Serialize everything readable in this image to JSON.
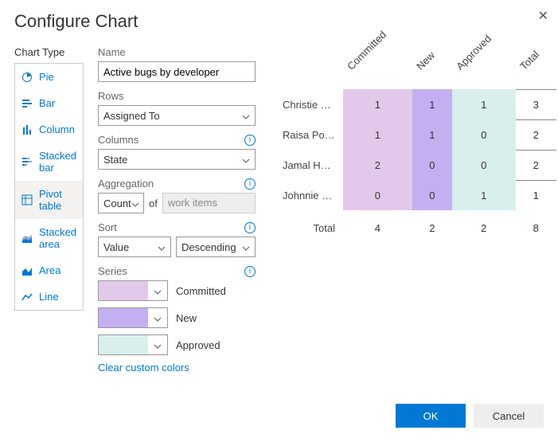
{
  "dialog": {
    "title": "Configure Chart"
  },
  "chartType": {
    "label": "Chart Type",
    "items": [
      {
        "key": "pie",
        "label": "Pie"
      },
      {
        "key": "bar",
        "label": "Bar"
      },
      {
        "key": "column",
        "label": "Column"
      },
      {
        "key": "stacked-bar",
        "label": "Stacked bar"
      },
      {
        "key": "pivot-table",
        "label": "Pivot table"
      },
      {
        "key": "stacked-area",
        "label": "Stacked area"
      },
      {
        "key": "area",
        "label": "Area"
      },
      {
        "key": "line",
        "label": "Line"
      }
    ],
    "selected": "pivot-table"
  },
  "form": {
    "nameLabel": "Name",
    "nameValue": "Active bugs by developer",
    "rowsLabel": "Rows",
    "rowsValue": "Assigned To",
    "columnsLabel": "Columns",
    "columnsValue": "State",
    "aggLabel": "Aggregation",
    "aggValue": "Count",
    "aggOf": "of",
    "aggWI": "work items",
    "sortLabel": "Sort",
    "sortBy": "Value",
    "sortDir": "Descending",
    "seriesLabel": "Series",
    "series": [
      {
        "label": "Committed",
        "color": "#e2c9ea"
      },
      {
        "label": "New",
        "color": "#c4b0f0"
      },
      {
        "label": "Approved",
        "color": "#d9efed"
      }
    ],
    "clearColors": "Clear custom colors"
  },
  "buttons": {
    "ok": "OK",
    "cancel": "Cancel"
  },
  "chart_data": {
    "type": "table",
    "columns": [
      "Committed",
      "New",
      "Approved",
      "Total"
    ],
    "rows": [
      {
        "label": "Christie Ch...",
        "values": [
          1,
          1,
          1,
          3
        ]
      },
      {
        "label": "Raisa Pokro...",
        "values": [
          1,
          1,
          0,
          2
        ]
      },
      {
        "label": "Jamal Hartn...",
        "values": [
          2,
          0,
          0,
          2
        ]
      },
      {
        "label": "Johnnie McL...",
        "values": [
          0,
          0,
          1,
          1
        ]
      }
    ],
    "totals": {
      "label": "Total",
      "values": [
        4,
        2,
        2,
        8
      ]
    },
    "column_colors": [
      "#e2c9ea",
      "#c4b0f0",
      "#d9efed",
      "#ffffff"
    ]
  }
}
